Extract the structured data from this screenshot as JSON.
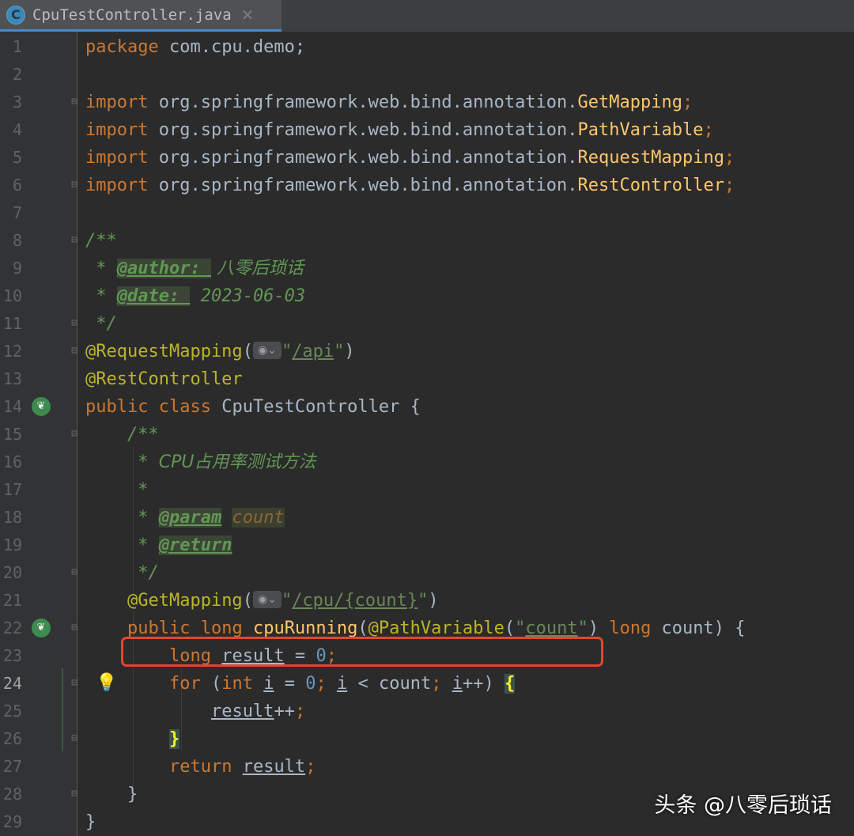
{
  "tab": {
    "icon_letter": "C",
    "filename": "CpuTestController.java",
    "close_glyph": "✕"
  },
  "lines": {
    "1": "1",
    "2": "2",
    "3": "3",
    "4": "4",
    "5": "5",
    "6": "6",
    "7": "7",
    "8": "8",
    "9": "9",
    "10": "10",
    "11": "11",
    "12": "12",
    "13": "13",
    "14": "14",
    "15": "15",
    "16": "16",
    "17": "17",
    "18": "18",
    "19": "19",
    "20": "20",
    "21": "21",
    "22": "22",
    "23": "23",
    "24": "24",
    "25": "25",
    "26": "26",
    "27": "27",
    "28": "28",
    "29": "29"
  },
  "code": {
    "package_kw": "package",
    "package_name": " com.cpu.demo;",
    "import_kw": "import",
    "import_pkg": " org.springframework.web.bind.annotation.",
    "imp1": "GetMapping",
    "imp2": "PathVariable",
    "imp3": "RequestMapping",
    "imp4": "RestController",
    "semi": ";",
    "doc_open": "/**",
    "doc_star": " * ",
    "doc_close": " */",
    "author_tag": "@author: ",
    "author_val": " 八零后琐话",
    "date_tag": "@date: ",
    "date_val": " 2023-06-03",
    "req_mapping": "@RequestMapping",
    "paren_open": "(",
    "api_path": "/api",
    "quote": "\"",
    "paren_close": ")",
    "rest_controller": "@RestController",
    "public_kw": "public",
    "class_kw": "class",
    "class_name": " CpuTestController {",
    "method_doc_desc": "CPU占用率测试方法",
    "param_tag": "@param",
    "param_val": "count",
    "return_tag": "@return",
    "get_mapping": "@GetMapping",
    "cpu_path": "/cpu/{count}",
    "long_kw": "long",
    "method_name": "cpuRunning",
    "path_variable": "@PathVariable",
    "count_str": "count",
    "count_param": " count) {",
    "result_var": "result",
    "assign": " = ",
    "zero": "0",
    "for_kw": "for",
    "int_kw": "int",
    "i_var": "i",
    "lt": " < ",
    "count_ref": "count",
    "inc": "++",
    "return_kw": "return",
    "open_brace": "{",
    "close_brace": "}"
  },
  "globe_icon": "globe-icon",
  "gutter_icons": [
    "spring-bean-icon",
    "spring-web-icon"
  ],
  "bulb_icon": "lightbulb-icon",
  "watermark": "头条 @八零后琐话",
  "colors": {
    "background": "#2b2b2b",
    "keyword": "#cc7832",
    "annotation": "#bbb529",
    "doc": "#629755",
    "string": "#6a8759",
    "number": "#6897bb",
    "function": "#ffc66d",
    "highlight_box": "#e3462f"
  }
}
